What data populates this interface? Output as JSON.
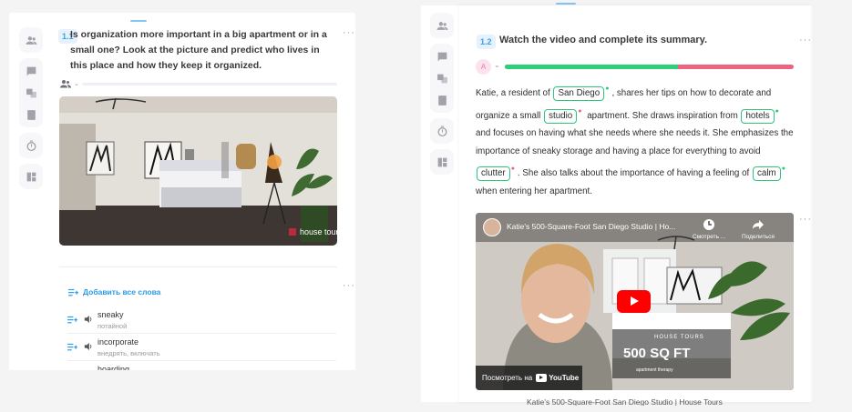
{
  "left_task": {
    "number": "1.1",
    "question": "Is organization more important in a big apartment or in a small one? Look at the picture and predict who lives in this place and how they keep it organized.",
    "photo_watermark": "house tours",
    "add_all_words": "Добавить все слова",
    "words": [
      {
        "word": "sneaky",
        "translation": "потайной"
      },
      {
        "word": "incorporate",
        "translation": "внедрять, включать"
      },
      {
        "word": "hoarding",
        "translation": ""
      }
    ]
  },
  "right_task": {
    "number": "1.2",
    "title": "Watch the video and complete its summary.",
    "avatar_letter": "A",
    "progress_correct": 0.6,
    "colors": {
      "correct": "#2fcf79",
      "incorrect": "#ec6480",
      "accent": "#2a9be6"
    },
    "summary": {
      "t1": "Katie, a resident of",
      "g1": "San Diego",
      "t2": ", shares her tips on how to decorate and organize a small",
      "g2": "studio",
      "t3": "apartment. She draws inspiration from",
      "g3": "hotels",
      "t4": "and focuses on having what she needs where she needs it. She emphasizes the importance of sneaky storage and having a place for everything to avoid",
      "g4": "clutter",
      "t5": ". She also talks about the importance of having a feeling of",
      "g5": "calm",
      "t6": "when entering her apartment."
    },
    "video": {
      "title": "Katie's 500-Square-Foot San Diego Studio | Ho...",
      "watch_later": "Смотреть ...",
      "share": "Поделиться",
      "watch_on": "Посмотреть на",
      "youtube": "YouTube",
      "brand_label": "HOUSE TOURS",
      "brand_size": "500 SQ FT",
      "brand_sub": "apartment therapy"
    },
    "caption_cut": "Katie's 500-Square-Foot San Diego Studio | House Tours"
  }
}
